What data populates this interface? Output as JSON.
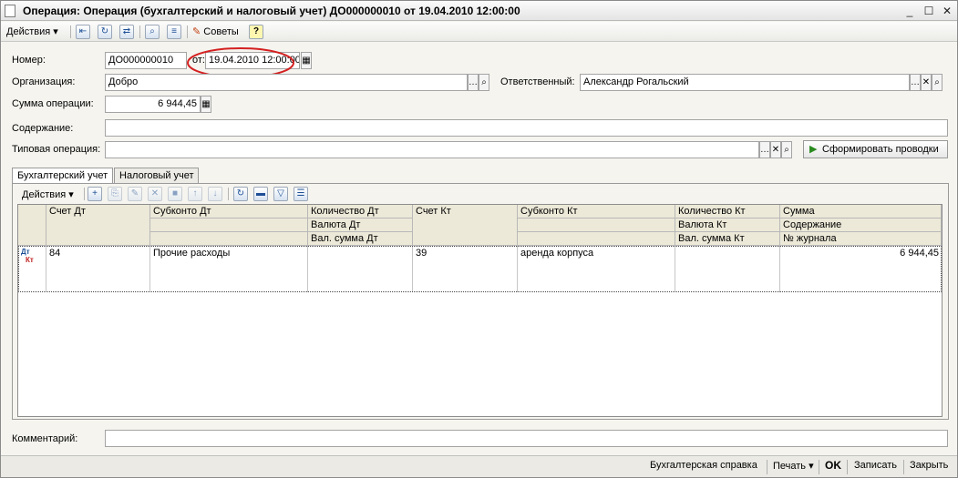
{
  "window": {
    "title": "Операция: Операция (бухгалтерский и налоговый учет) ДО000000010 от 19.04.2010 12:00:00",
    "minimize": "_",
    "maximize": "☐",
    "close": "✕"
  },
  "toolbar": {
    "actions_label": "Действия",
    "tips_label": "Советы",
    "help_label": "?"
  },
  "form": {
    "number_label": "Номер:",
    "number_value": "ДО000000010",
    "date_label": "от:",
    "date_value": "19.04.2010 12:00:00",
    "org_label": "Организация:",
    "org_value": "Добро",
    "responsible_label": "Ответственный:",
    "responsible_value": "Александр Рогальский",
    "sum_label": "Сумма операции:",
    "sum_value": "6 944,45",
    "content_label": "Содержание:",
    "content_value": "",
    "typical_label": "Типовая операция:",
    "typical_value": "",
    "generate_button": "Сформировать проводки",
    "comment_label": "Комментарий:",
    "comment_value": ""
  },
  "tabs": [
    "Бухгалтерский учет",
    "Налоговый учет"
  ],
  "table_toolbar": {
    "actions_label": "Действия"
  },
  "table": {
    "headers": {
      "schet_dt": "Счет Дт",
      "subkonto_dt": "Субконто Дт",
      "kol_dt": "Количество Дт",
      "val_dt": "Валюта Дт",
      "valsum_dt": "Вал. сумма Дт",
      "schet_kt": "Счет Кт",
      "subkonto_kt": "Субконто Кт",
      "kol_kt": "Количество Кт",
      "val_kt": "Валюта Кт",
      "valsum_kt": "Вал. сумма Кт",
      "summa": "Сумма",
      "soderzhanie": "Содержание",
      "journal": "№ журнала"
    },
    "rows": [
      {
        "icon_dt": "Дт",
        "icon_kt": "Кт",
        "schet_dt": "84",
        "subkonto_dt": "Прочие расходы",
        "kol_dt": "",
        "schet_kt": "39",
        "subkonto_kt": "аренда корпуса",
        "kol_kt": "",
        "summa": "6 944,45"
      }
    ]
  },
  "statusbar": {
    "spravka": "Бухгалтерская справка",
    "print": "Печать",
    "ok": "OK",
    "save": "Записать",
    "close": "Закрыть"
  },
  "colors": {
    "highlight_circle": "#d42020",
    "accent_green": "#2a8a1f"
  }
}
